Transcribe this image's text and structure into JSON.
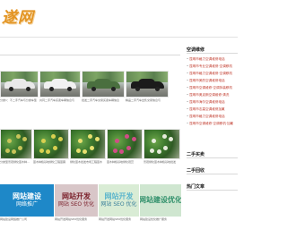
{
  "header": {
    "logo_text": "遂网"
  },
  "main": {
    "row1": [
      {
        "caption": "分类1：不二手汽车与分类车型",
        "image": "car",
        "car_color": "#e9e9e9"
      },
      {
        "caption": "共同二手汽车买卖车辆信息与",
        "image": "car",
        "car_color": "#f1f1f1"
      },
      {
        "caption": "批发二手汽车交易买卖车辆信息",
        "image": "car",
        "car_color": "#4a6f3f"
      },
      {
        "caption": "精品二手汽车出售交易信息与",
        "image": "car",
        "car_color": "#1b1b1b"
      }
    ],
    "row2": [
      {
        "caption": "分类型景观绿化苗木种植基地",
        "image": "plant",
        "flower_color": "#c8c45a"
      },
      {
        "caption": "苗木种植基地绿化工程苗圃",
        "image": "plant",
        "flower_color": "#d9d050"
      },
      {
        "caption": "绿化苗木批发市场工程苗木",
        "image": "plant",
        "flower_color": "#e8e070"
      },
      {
        "caption": "苗木种植基地绿化观赏",
        "image": "plant",
        "flower_color": "#d04d86"
      },
      {
        "caption": "景观绿化苗木种植基地批发",
        "image": "plant",
        "flower_color": "#e7ecdc"
      }
    ],
    "ads": [
      {
        "line1": "网站建设",
        "line2": "网络推广",
        "caption": "网站建设网络推广公司",
        "bg": "#1e88c8",
        "fg": "#ffffff",
        "fg2": "#ffffff"
      },
      {
        "line1": "网站开发",
        "line2": "网站 SEO 优化",
        "caption": "网站开发网站SEO优化服务",
        "bg": "#d8c6c8",
        "fg": "#7a1f2a",
        "fg2": "#7a1f2a"
      },
      {
        "line1": "网站开发",
        "line2": "网站 SEO 优化",
        "caption": "网站开发网站SEO优化服务",
        "bg": "#d9ecd5",
        "fg": "#5bb5cc",
        "fg2": "#3a7f9a"
      },
      {
        "line1": "网站建设优化",
        "line2": "",
        "caption": "网站建设优化推广服务",
        "bg": "#cfe6d0",
        "fg": "#2f8f6a",
        "fg2": "#2f8f6a"
      }
    ]
  },
  "sidebar": {
    "section1_title": "空调维修",
    "section1_items": [
      "昆明市格力空调维修电话",
      "昆明市专业空调维修·空调移机",
      "昆明市格力空调维修·空调移机",
      "昆明市美的空调维修电话",
      "昆明市空调维修·空调拆装移机",
      "昆明市奥克斯空调维修·清洗",
      "昆明市海尔空调维修电话",
      "昆明市志高空调维修加氟",
      "昆明市格力空调维修电话",
      "昆明市空调维修·空调移机·加氟"
    ],
    "section2_title": "二手买卖",
    "section3_title": "二手回收",
    "section4_title": "热门文章"
  }
}
